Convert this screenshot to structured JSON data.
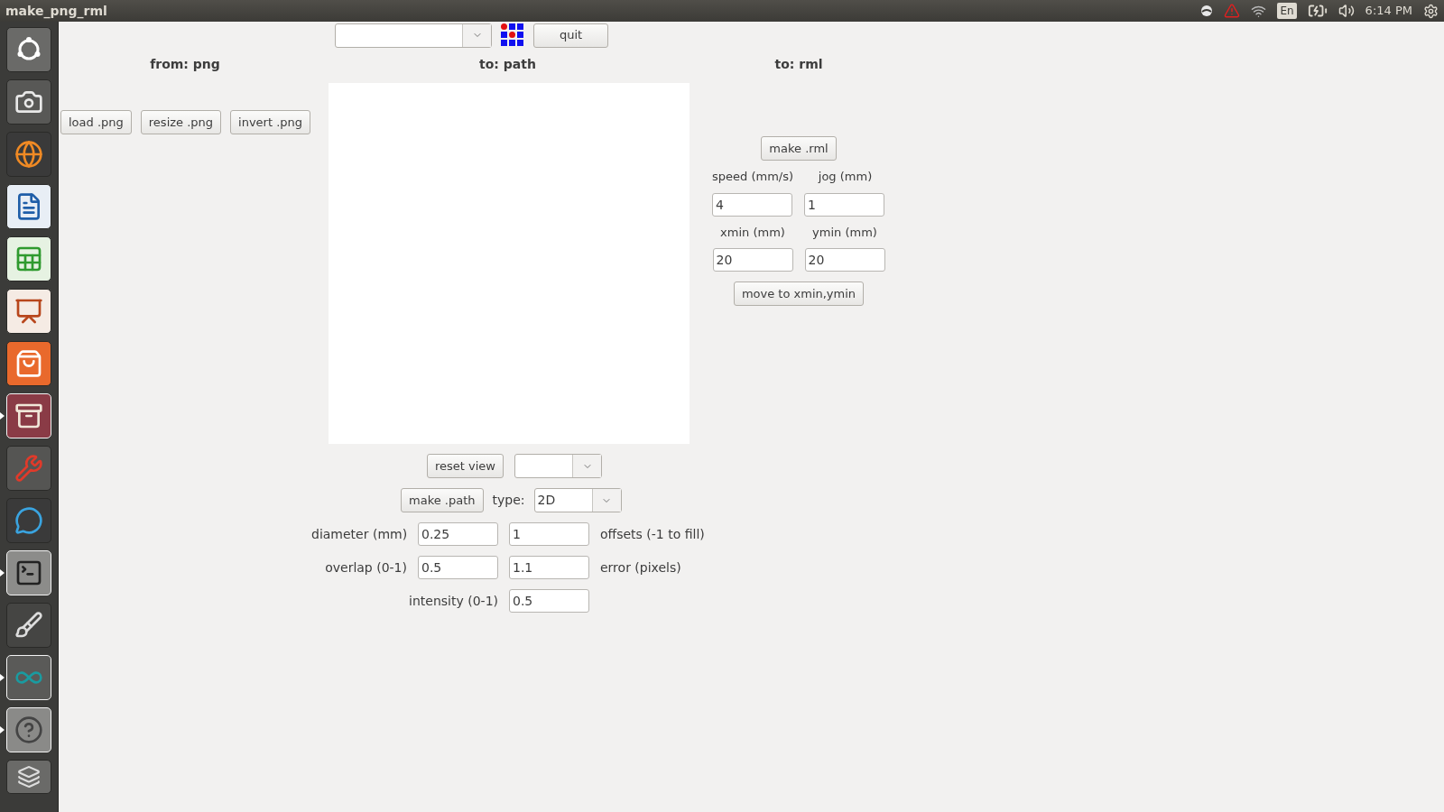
{
  "window": {
    "title": "make_png_rml"
  },
  "top_panel": {
    "keyboard": "En",
    "clock": "6:14 PM"
  },
  "launcher": [
    {
      "kind": "dash",
      "running": false
    },
    {
      "kind": "camera",
      "running": false
    },
    {
      "kind": "browser",
      "running": false
    },
    {
      "kind": "writer",
      "running": false
    },
    {
      "kind": "calc",
      "running": false
    },
    {
      "kind": "impress",
      "running": false
    },
    {
      "kind": "store",
      "running": false
    },
    {
      "kind": "files",
      "running": true
    },
    {
      "kind": "settings",
      "running": false
    },
    {
      "kind": "chat",
      "running": false
    },
    {
      "kind": "terminal",
      "running": true
    },
    {
      "kind": "paint",
      "running": false
    },
    {
      "kind": "arduino",
      "running": true
    },
    {
      "kind": "help",
      "running": true
    },
    {
      "kind": "stack",
      "running": false
    }
  ],
  "toolbar": {
    "button": "quit"
  },
  "from_png": {
    "title": "from: png",
    "buttons": [
      "load .png",
      "resize .png",
      "invert .png"
    ]
  },
  "to_path": {
    "title": "to: path",
    "reset_button": "reset view",
    "make_button": "make .path",
    "type_label": "type:",
    "type_value": "2D",
    "rows": [
      {
        "left_label": "diameter (mm)",
        "values": [
          "0.25",
          "1"
        ],
        "right_label": "offsets (-1 to fill)"
      },
      {
        "left_label": "overlap (0-1)",
        "values": [
          "0.5",
          "1.1"
        ],
        "right_label": "error (pixels)"
      }
    ],
    "intensity": {
      "label": "intensity (0-1)",
      "value": "0.5"
    }
  },
  "to_rml": {
    "title": "to: rml",
    "button": "make .rml",
    "fields": [
      {
        "label": "speed (mm/s)",
        "value": "4"
      },
      {
        "label": "jog (mm)",
        "value": "1"
      },
      {
        "label": "xmin (mm)",
        "value": "20"
      },
      {
        "label": "ymin (mm)",
        "value": "20"
      }
    ],
    "move_button": "move to xmin,ymin"
  }
}
